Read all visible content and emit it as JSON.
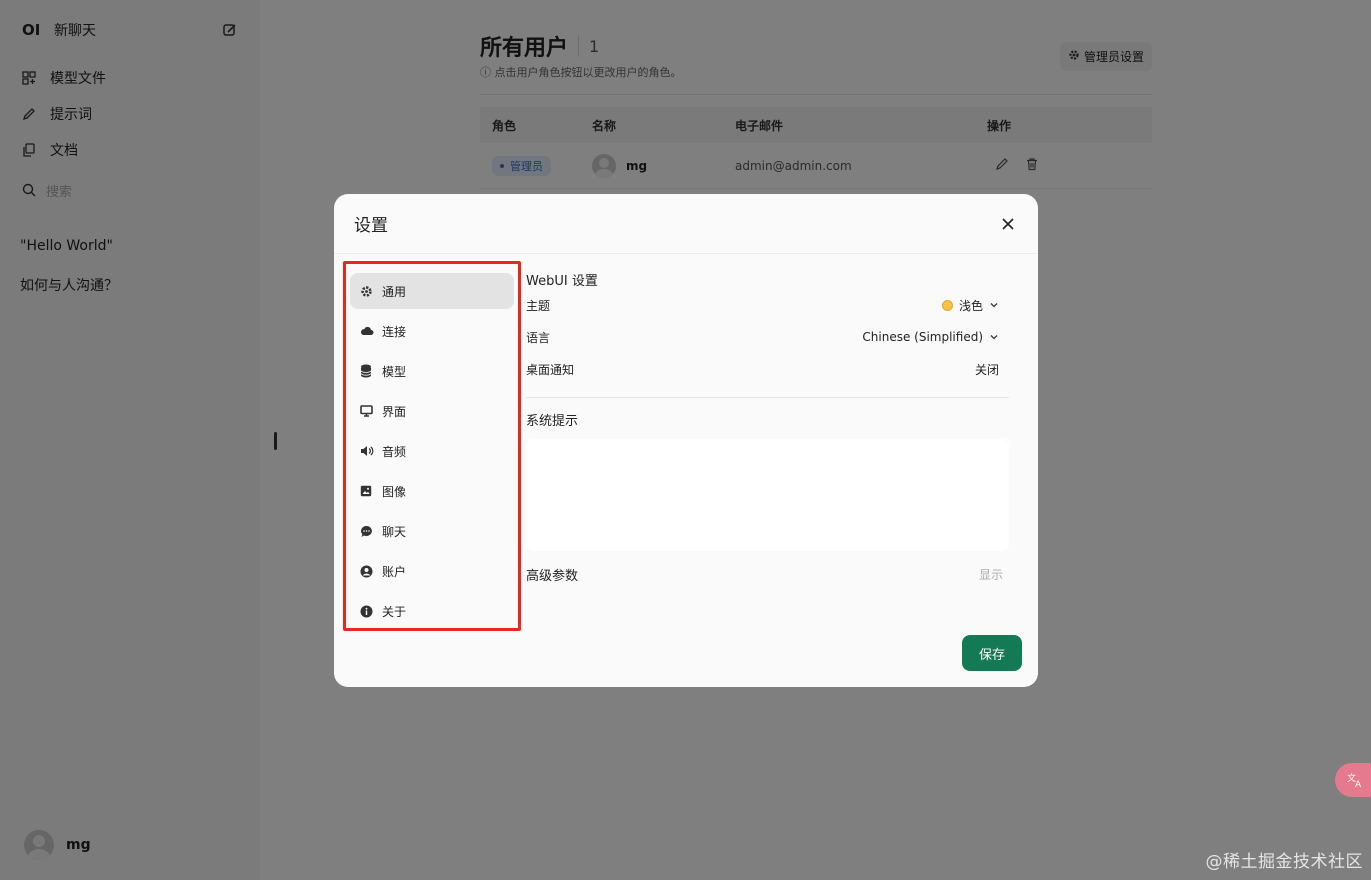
{
  "sidebar": {
    "logo": "OI",
    "new_chat": "新聊天",
    "nav": [
      {
        "label": "模型文件",
        "icon": "grid-icon"
      },
      {
        "label": "提示词",
        "icon": "pencil-icon"
      },
      {
        "label": "文档",
        "icon": "documents-icon"
      }
    ],
    "search_placeholder": "搜索",
    "chats": [
      "\"Hello World\"",
      "如何与人沟通？"
    ],
    "user_name": "mg"
  },
  "main": {
    "title": "所有用户",
    "count": "1",
    "admin_settings": "管理员设置",
    "hint": "ⓘ 点击用户角色按钮以更改用户的角色。",
    "table": {
      "headers": [
        "角色",
        "名称",
        "电子邮件",
        "操作"
      ],
      "rows": [
        {
          "role": "管理员",
          "name": "mg",
          "email": "admin@admin.com"
        }
      ]
    }
  },
  "modal": {
    "title": "设置",
    "tabs": [
      {
        "label": "通用",
        "icon": "gear-icon",
        "active": true
      },
      {
        "label": "连接",
        "icon": "cloud-icon"
      },
      {
        "label": "模型",
        "icon": "database-icon"
      },
      {
        "label": "界面",
        "icon": "monitor-icon"
      },
      {
        "label": "音频",
        "icon": "speaker-icon"
      },
      {
        "label": "图像",
        "icon": "image-icon"
      },
      {
        "label": "聊天",
        "icon": "chat-bubble-icon"
      },
      {
        "label": "账户",
        "icon": "user-circle-icon"
      },
      {
        "label": "关于",
        "icon": "info-icon"
      }
    ],
    "panel": {
      "section_title": "WebUI 设置",
      "theme_label": "主题",
      "theme_value": "浅色",
      "language_label": "语言",
      "language_value": "Chinese (Simplified)",
      "notify_label": "桌面通知",
      "notify_value": "关闭",
      "system_prompt_label": "系统提示",
      "advanced_label": "高级参数",
      "advanced_toggle": "显示"
    },
    "save": "保存"
  },
  "translate_icon": "translate-icon",
  "watermark": "@稀土掘金技术社区"
}
